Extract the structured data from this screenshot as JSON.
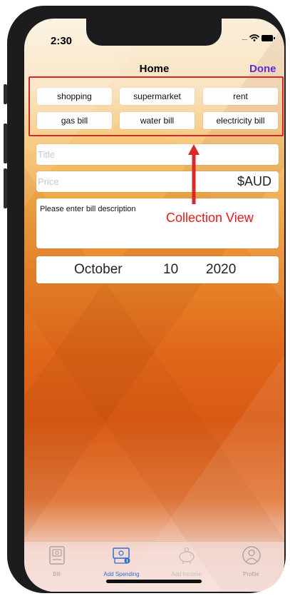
{
  "status": {
    "time": "2:30",
    "signal_dots": "....."
  },
  "nav": {
    "title": "Home",
    "done_label": "Done"
  },
  "categories": [
    "shopping",
    "supermarket",
    "rent",
    "gas bill",
    "water bill",
    "electricity bill"
  ],
  "form": {
    "title_placeholder": "Title",
    "price_placeholder": "Price",
    "currency": "$AUD",
    "description_placeholder": "Please enter bill description"
  },
  "date": {
    "month": "October",
    "day": "10",
    "year": "2020"
  },
  "annotation": {
    "label": "Collection View"
  },
  "tabs": [
    {
      "label": "Bill",
      "icon": "bill-icon",
      "active": false
    },
    {
      "label": "Add Spending",
      "icon": "add-spending-icon",
      "active": true
    },
    {
      "label": "Add Income",
      "icon": "piggy-bank-icon",
      "active": false
    },
    {
      "label": "Profile",
      "icon": "profile-icon",
      "active": false
    }
  ],
  "colors": {
    "accent": "#5b2fd1",
    "tab_active": "#2f6fd6",
    "tab_inactive": "#a8a3a3",
    "annotation": "#d62a2a"
  }
}
